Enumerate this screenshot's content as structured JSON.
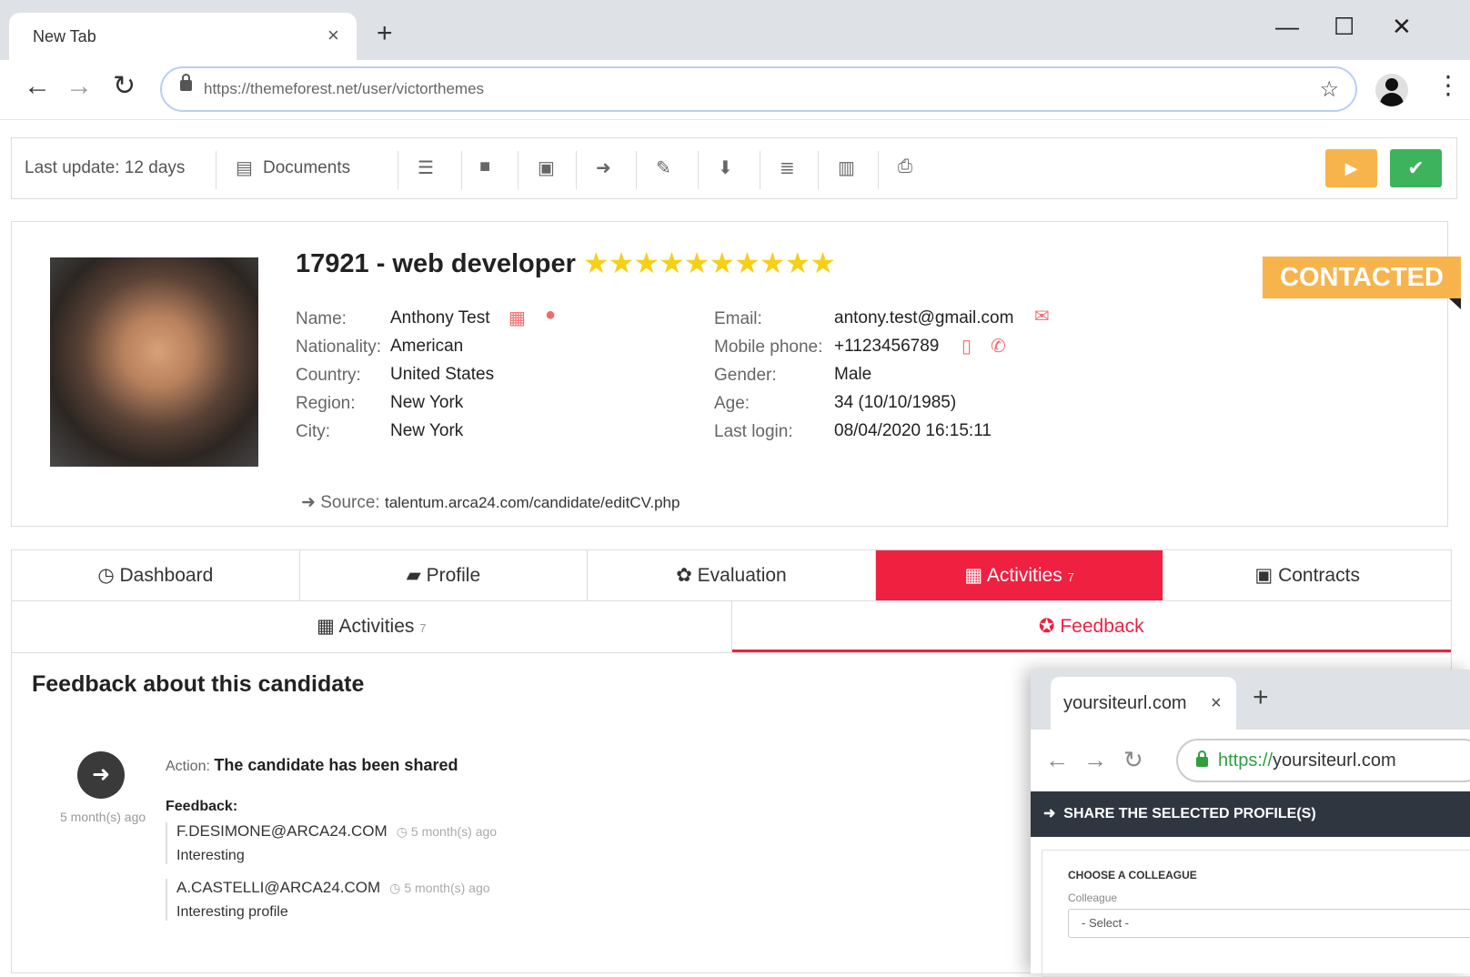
{
  "browser": {
    "tab_title": "New Tab",
    "tab_close": "×",
    "new_tab": "+",
    "url": "https://themeforest.net/user/victorthemes",
    "window": {
      "minimize": "—",
      "maximize": "☐",
      "close": "✕"
    },
    "nav": {
      "back": "←",
      "forward": "→",
      "reload": "↻"
    },
    "bookmark": "☆",
    "menu": "⋮"
  },
  "toolbar": {
    "last_update": "Last update: 12 days",
    "documents": "Documents",
    "icons": [
      "list-icon",
      "video-icon",
      "id-card-icon",
      "share-icon",
      "pencil-icon",
      "inbox-icon",
      "stack-icon",
      "briefcase-icon",
      "print-icon"
    ],
    "play": "▶",
    "check": "✔"
  },
  "candidate": {
    "title": "17921 - web developer",
    "stars": "★★★★★★★★★★",
    "rating_stars": 10,
    "status": "CONTACTED",
    "labels": {
      "name": "Name:",
      "nationality": "Nationality:",
      "country": "Country:",
      "region": "Region:",
      "city": "City:",
      "email": "Email:",
      "mobile": "Mobile phone:",
      "gender": "Gender:",
      "age": "Age:",
      "last_login": "Last login:"
    },
    "values": {
      "name": "Anthony Test",
      "nationality": "American",
      "country": "United States",
      "region": "New York",
      "city": "New York",
      "email": "antony.test@gmail.com",
      "mobile": "+1123456789",
      "gender": "Male",
      "age": "34 (10/10/1985)",
      "last_login": "08/04/2020 16:15:11"
    },
    "source_label": "Source:",
    "source_url": "talentum.arca24.com/candidate/editCV.php"
  },
  "main_tabs": [
    {
      "label": "Dashboard",
      "icon": "◷"
    },
    {
      "label": "Profile",
      "icon": "▰"
    },
    {
      "label": "Evaluation",
      "icon": "✿"
    },
    {
      "label": "Activities",
      "icon": "▦",
      "count": "7"
    },
    {
      "label": "Contracts",
      "icon": "▣"
    }
  ],
  "sub_tabs": [
    {
      "label": "Activities",
      "icon": "▦",
      "count": "7"
    },
    {
      "label": "Feedback",
      "icon": "✪"
    }
  ],
  "feedback": {
    "title": "Feedback about this candidate",
    "time_ago": "5 month(s) ago",
    "action_label": "Action:",
    "action_text": "The candidate has been shared",
    "feedback_label": "Feedback:",
    "entries": [
      {
        "email": "F.DESIMONE@ARCA24.COM",
        "time": "5 month(s) ago",
        "text": "Interesting"
      },
      {
        "email": "A.CASTELLI@ARCA24.COM",
        "time": "5 month(s) ago",
        "text": "Interesting profile"
      }
    ]
  },
  "popup": {
    "tab_title": "yoursiteurl.com",
    "tab_close": "×",
    "new_tab": "+",
    "url_scheme": "https://",
    "url_host": "yoursiteurl.com",
    "bar_title": "SHARE THE SELECTED PROFILE(S)",
    "choose_label": "CHOOSE A COLLEAGUE",
    "colleague_label": "Colleague",
    "select_value": "- Select -"
  },
  "colors": {
    "accent_red": "#f02040",
    "orange": "#f7b44c",
    "green": "#3cb35c",
    "star_yellow": "#f5d016"
  }
}
